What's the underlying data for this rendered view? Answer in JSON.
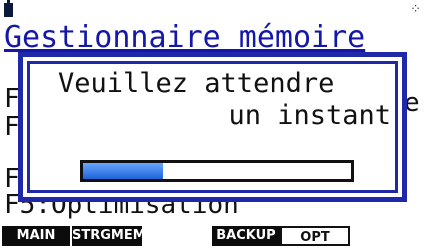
{
  "status": {
    "battery_icon": "battery-icon",
    "busy_icon": "busy-spinner-icon",
    "busy_glyph": "⁘"
  },
  "menu": {
    "title": "Gestionnaire mémoire",
    "line1": "F1",
    "line1_tail": "e",
    "line2": "F2",
    "line4": "F4",
    "line5": "F5:Optimisation"
  },
  "dialog": {
    "line1": "Veuillez attendre",
    "line2": "un instant",
    "progress": 0.3
  },
  "softkeys": [
    "MAIN",
    "STRGMEM",
    "BACKUP",
    "OPT"
  ],
  "colors": {
    "title": "#1417a8",
    "dialog_border": "#1f28a8",
    "progress": "#2f7ae8"
  }
}
